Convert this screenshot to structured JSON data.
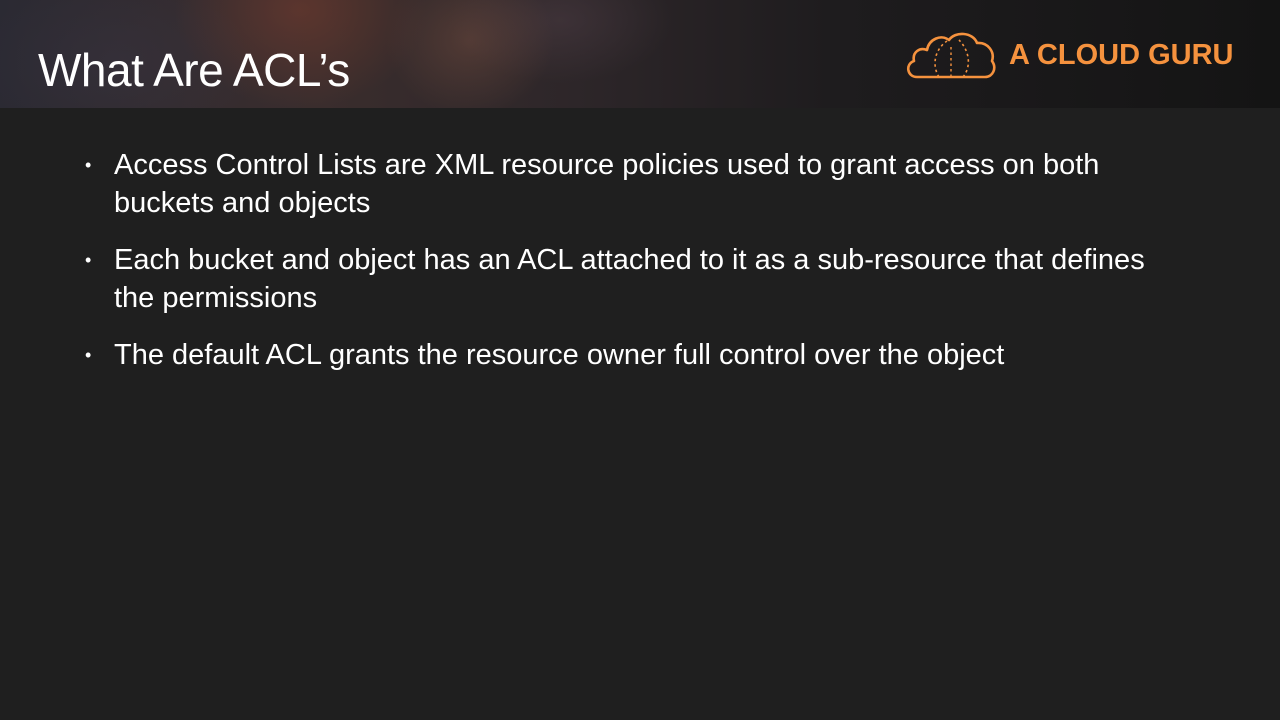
{
  "slide": {
    "title": "What Are ACL’s",
    "logo": {
      "icon": "cloud-icon",
      "text": "A CLOUD GURU",
      "color": "#f5923e"
    },
    "bullets": [
      {
        "marker": "•",
        "text": "Access Control Lists are XML resource policies used to grant access on both buckets and objects"
      },
      {
        "marker": "•",
        "text": "Each bucket and object has an ACL attached to it as a sub-resource that defines the permissions"
      },
      {
        "marker": "•",
        "text": "The default ACL grants the resource owner full control over the object"
      }
    ]
  }
}
